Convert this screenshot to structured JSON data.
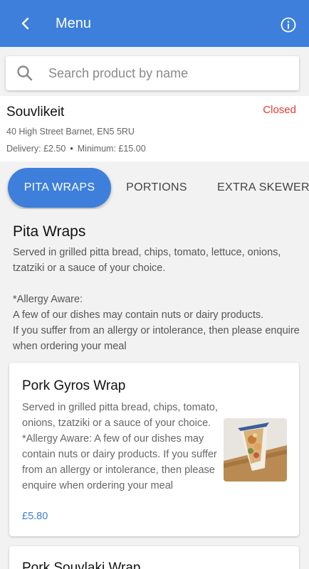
{
  "appbar": {
    "title": "Menu",
    "back_icon": "chevron-left-icon",
    "info_icon": "info-icon"
  },
  "search": {
    "placeholder": "Search product by name",
    "value": ""
  },
  "store": {
    "name": "Souvlikeit",
    "status": "Closed",
    "address": "40 High Street Barnet, EN5 5RU",
    "delivery": "Delivery: £2.50",
    "separator": "•",
    "minimum": "Minimum: £15.00"
  },
  "tabs": [
    {
      "label": "PITA WRAPS",
      "active": true
    },
    {
      "label": "PORTIONS",
      "active": false
    },
    {
      "label": "EXTRA SKEWERS",
      "active": false
    }
  ],
  "section": {
    "title": "Pita Wraps",
    "description": "Served in grilled pitta bread, chips, tomato, lettuce, onions, tzatziki or a sauce of your choice.\n\n*Allergy Aware:\nA few of our dishes may contain nuts or dairy products.\nIf you suffer from an allergy or intolerance, then please enquire when ordering your meal"
  },
  "products": [
    {
      "name": "Pork Gyros Wrap",
      "description": "Served in grilled pitta bread, chips, tomato,  onions, tzatziki or a sauce of your choice. *Allergy Aware: A few of our dishes may contain nuts or dairy products. If you suffer from an allergy or intolerance, then please enquire when ordering your meal",
      "price": "£5.80"
    },
    {
      "name": "Pork Souvlaki Wrap"
    }
  ],
  "colors": {
    "primary": "#3d7fdb",
    "closed": "#e53935",
    "background": "#f2f2f2"
  }
}
